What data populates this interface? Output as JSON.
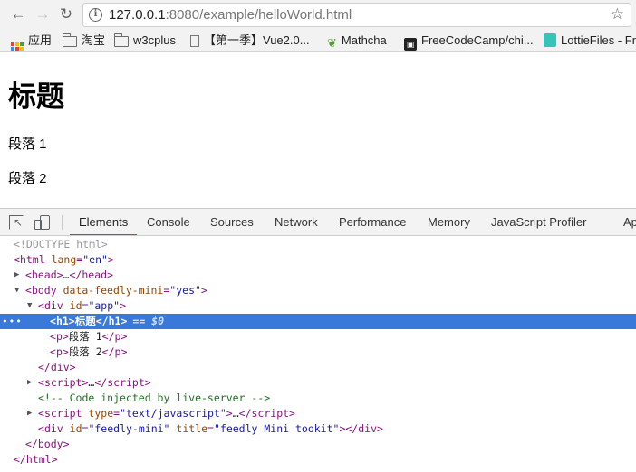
{
  "browser": {
    "url_host": "127.0.0.1",
    "url_rest": ":8080/example/helloWorld.html",
    "back_icon": "arrow-left-icon",
    "forward_icon": "arrow-right-icon",
    "reload_icon": "reload-icon",
    "star_icon": "star-icon"
  },
  "bookmarks": [
    {
      "label": "应用",
      "icon": "apps-icon"
    },
    {
      "label": "淘宝",
      "icon": "folder-icon"
    },
    {
      "label": "w3cplus",
      "icon": "folder-icon"
    },
    {
      "label": "【第一季】Vue2.0...",
      "icon": "page-icon"
    },
    {
      "label": "Mathcha",
      "icon": "mathcha-icon"
    },
    {
      "label": "FreeCodeCamp/chi...",
      "icon": "freecodecamp-icon"
    },
    {
      "label": "LottieFiles - Fr",
      "icon": "lottie-icon"
    }
  ],
  "page": {
    "heading": "标题",
    "paragraph1": "段落 1",
    "paragraph2": "段落 2"
  },
  "devtools": {
    "tabs": [
      "Elements",
      "Console",
      "Sources",
      "Network",
      "Performance",
      "Memory",
      "JavaScript Profiler",
      "Ap"
    ],
    "active_tab": "Elements",
    "colors": {
      "selected_row": "#3879d9",
      "active_tab_underline": "#1a73e8"
    },
    "dom": {
      "doctype": "<!DOCTYPE html>",
      "html_open_tag": "html",
      "html_lang_attr": "lang",
      "html_lang_val": "\"en\"",
      "head": "head",
      "body_tag": "body",
      "body_attr": "data-feedly-mini",
      "body_val": "\"yes\"",
      "div_tag": "div",
      "div_attr": "id",
      "div_val": "\"app\"",
      "h1_tag": "h1",
      "h1_text": "标题",
      "selected_marker": "== $0",
      "p_tag": "p",
      "p1_text": "段落 1",
      "p2_text": "段落 2",
      "script_tag": "script",
      "comment": "<!-- Code injected by live-server -->",
      "script2_attr": "type",
      "script2_val": "\"text/javascript\"",
      "feedly_div_attr1": "id",
      "feedly_div_val1": "\"feedly-mini\"",
      "feedly_div_attr2": "title",
      "feedly_div_val2": "\"feedly Mini tookit\"",
      "ellipsis": "…"
    }
  }
}
